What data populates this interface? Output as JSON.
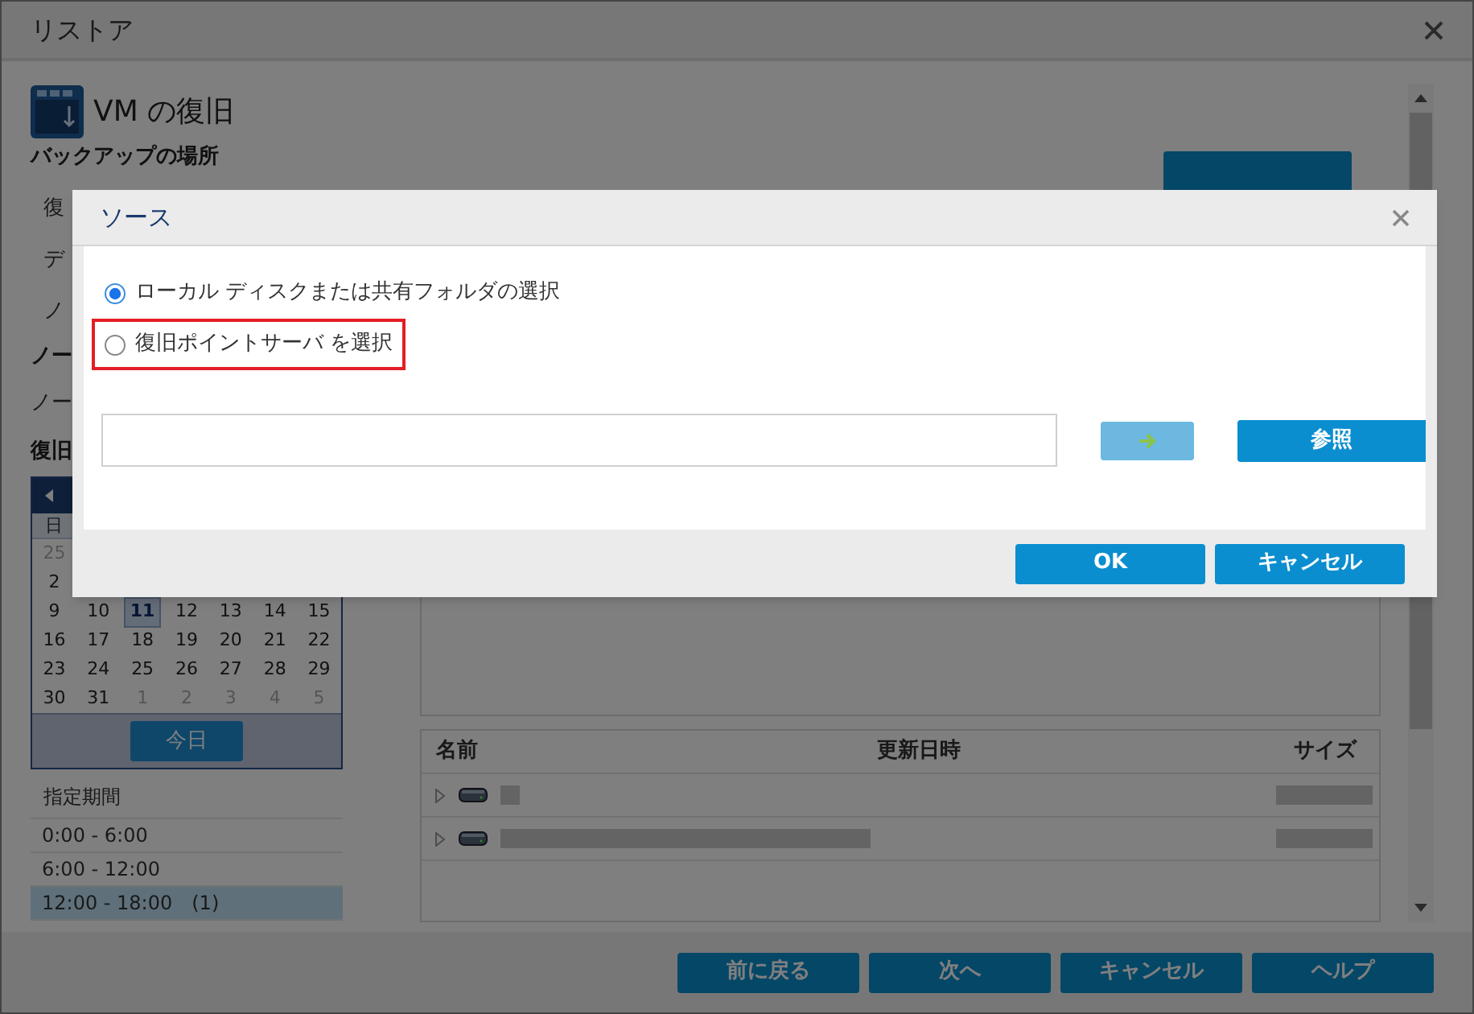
{
  "window": {
    "title": "リストア"
  },
  "page": {
    "heading": "VM の復旧",
    "section": "バックアップの場所",
    "rows": [
      "復",
      "デ",
      "ノ"
    ],
    "node_heading": "ノー",
    "node_row": "ノー",
    "recovery_heading": "復旧"
  },
  "calendar": {
    "weekday": "日",
    "weeks": [
      [
        {
          "d": "25",
          "muted": true,
          "selected": false
        }
      ],
      [
        {
          "d": "2",
          "muted": false,
          "selected": false
        }
      ],
      [
        {
          "d": "9",
          "muted": false,
          "selected": false
        },
        {
          "d": "10",
          "muted": false,
          "selected": false
        },
        {
          "d": "11",
          "muted": false,
          "selected": true
        },
        {
          "d": "12",
          "muted": false,
          "selected": false
        },
        {
          "d": "13",
          "muted": false,
          "selected": false
        },
        {
          "d": "14",
          "muted": false,
          "selected": false
        },
        {
          "d": "15",
          "muted": false,
          "selected": false
        }
      ],
      [
        {
          "d": "16",
          "muted": false,
          "selected": false
        },
        {
          "d": "17",
          "muted": false,
          "selected": false
        },
        {
          "d": "18",
          "muted": false,
          "selected": false
        },
        {
          "d": "19",
          "muted": false,
          "selected": false
        },
        {
          "d": "20",
          "muted": false,
          "selected": false
        },
        {
          "d": "21",
          "muted": false,
          "selected": false
        },
        {
          "d": "22",
          "muted": false,
          "selected": false
        }
      ],
      [
        {
          "d": "23",
          "muted": false,
          "selected": false
        },
        {
          "d": "24",
          "muted": false,
          "selected": false
        },
        {
          "d": "25",
          "muted": false,
          "selected": false
        },
        {
          "d": "26",
          "muted": false,
          "selected": false
        },
        {
          "d": "27",
          "muted": false,
          "selected": false
        },
        {
          "d": "28",
          "muted": false,
          "selected": false
        },
        {
          "d": "29",
          "muted": false,
          "selected": false
        }
      ],
      [
        {
          "d": "30",
          "muted": false,
          "selected": false
        },
        {
          "d": "31",
          "muted": false,
          "selected": false
        },
        {
          "d": "1",
          "muted": true,
          "selected": false
        },
        {
          "d": "2",
          "muted": true,
          "selected": false
        },
        {
          "d": "3",
          "muted": true,
          "selected": false
        },
        {
          "d": "4",
          "muted": true,
          "selected": false
        },
        {
          "d": "5",
          "muted": true,
          "selected": false
        }
      ]
    ],
    "today_button": "今日"
  },
  "periods": {
    "title": "指定期間",
    "items": [
      {
        "label": "0:00 - 6:00",
        "selected": false
      },
      {
        "label": "6:00 - 12:00",
        "selected": false
      },
      {
        "label": "12:00 - 18:00　(1)",
        "selected": true
      }
    ]
  },
  "table": {
    "columns": [
      "名前",
      "更新日時",
      "サイズ"
    ],
    "rows": [
      {
        "expanded": false
      },
      {
        "expanded": false
      }
    ]
  },
  "footer_buttons": [
    "前に戻る",
    "次へ",
    "キャンセル",
    "ヘルプ"
  ],
  "dialog": {
    "title": "ソース",
    "options": [
      {
        "label": "ローカル ディスクまたは共有フォルダの選択",
        "selected": true,
        "highlighted": false
      },
      {
        "label": "復旧ポイントサーバ を選択",
        "selected": false,
        "highlighted": true
      }
    ],
    "go_button": {
      "disabled": true
    },
    "browse_button": "参照",
    "buttons": [
      "OK",
      "キャンセル"
    ]
  }
}
